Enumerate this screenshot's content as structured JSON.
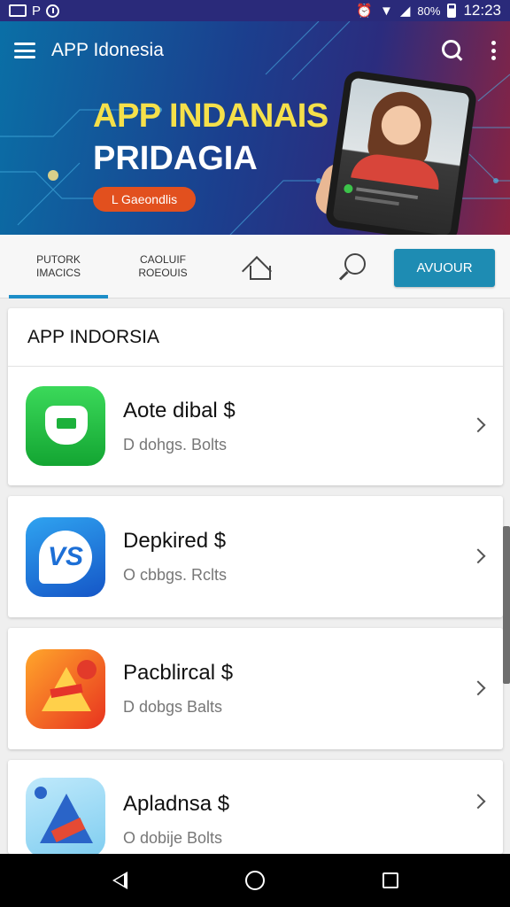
{
  "status_bar": {
    "left_glyph": "P",
    "battery": "80%",
    "time": "12:23",
    "icons": [
      "screenshot-icon",
      "clock-icon",
      "alarm-icon",
      "wifi-icon",
      "signal-icon",
      "battery-icon"
    ]
  },
  "app_bar": {
    "title": "APP Idonesia",
    "icons": [
      "menu-icon",
      "search-icon",
      "more-vert-icon"
    ]
  },
  "banner": {
    "headline_1": "APP INDANAIS",
    "headline_2": "PRIDAGIA",
    "button_label": "L Gaeondlis",
    "colors": {
      "headline_1": "#f5e04a",
      "button": "#e2501e"
    }
  },
  "tabs": {
    "tab1_line1": "PUTORK",
    "tab1_line2": "IMACICS",
    "tab2_line1": "CAOLUIF",
    "tab2_line2": "ROEOUIS",
    "home_icon": "home-icon",
    "search_icon": "search-icon",
    "cta_label": "AVUOUR",
    "accent": "#1d8ec8"
  },
  "section": {
    "title": "APP INDORSIA"
  },
  "apps": [
    {
      "name": "Aote dibal $",
      "meta": "D dohgs.  Bolts",
      "icon": "green-shield-icon"
    },
    {
      "name": "Depkired $",
      "meta": "O cbbgs.  Rclts",
      "icon": "blue-badge-icon"
    },
    {
      "name": "Pacblircal $",
      "meta": "D dobgs  Balts",
      "icon": "orange-triangle-icon"
    },
    {
      "name": "Apladnsa $",
      "meta": "O dobije  Bolts",
      "icon": "blue-triangle-icon"
    }
  ],
  "nav_bar": {
    "icons": [
      "back-icon",
      "home-icon",
      "recents-icon"
    ]
  }
}
